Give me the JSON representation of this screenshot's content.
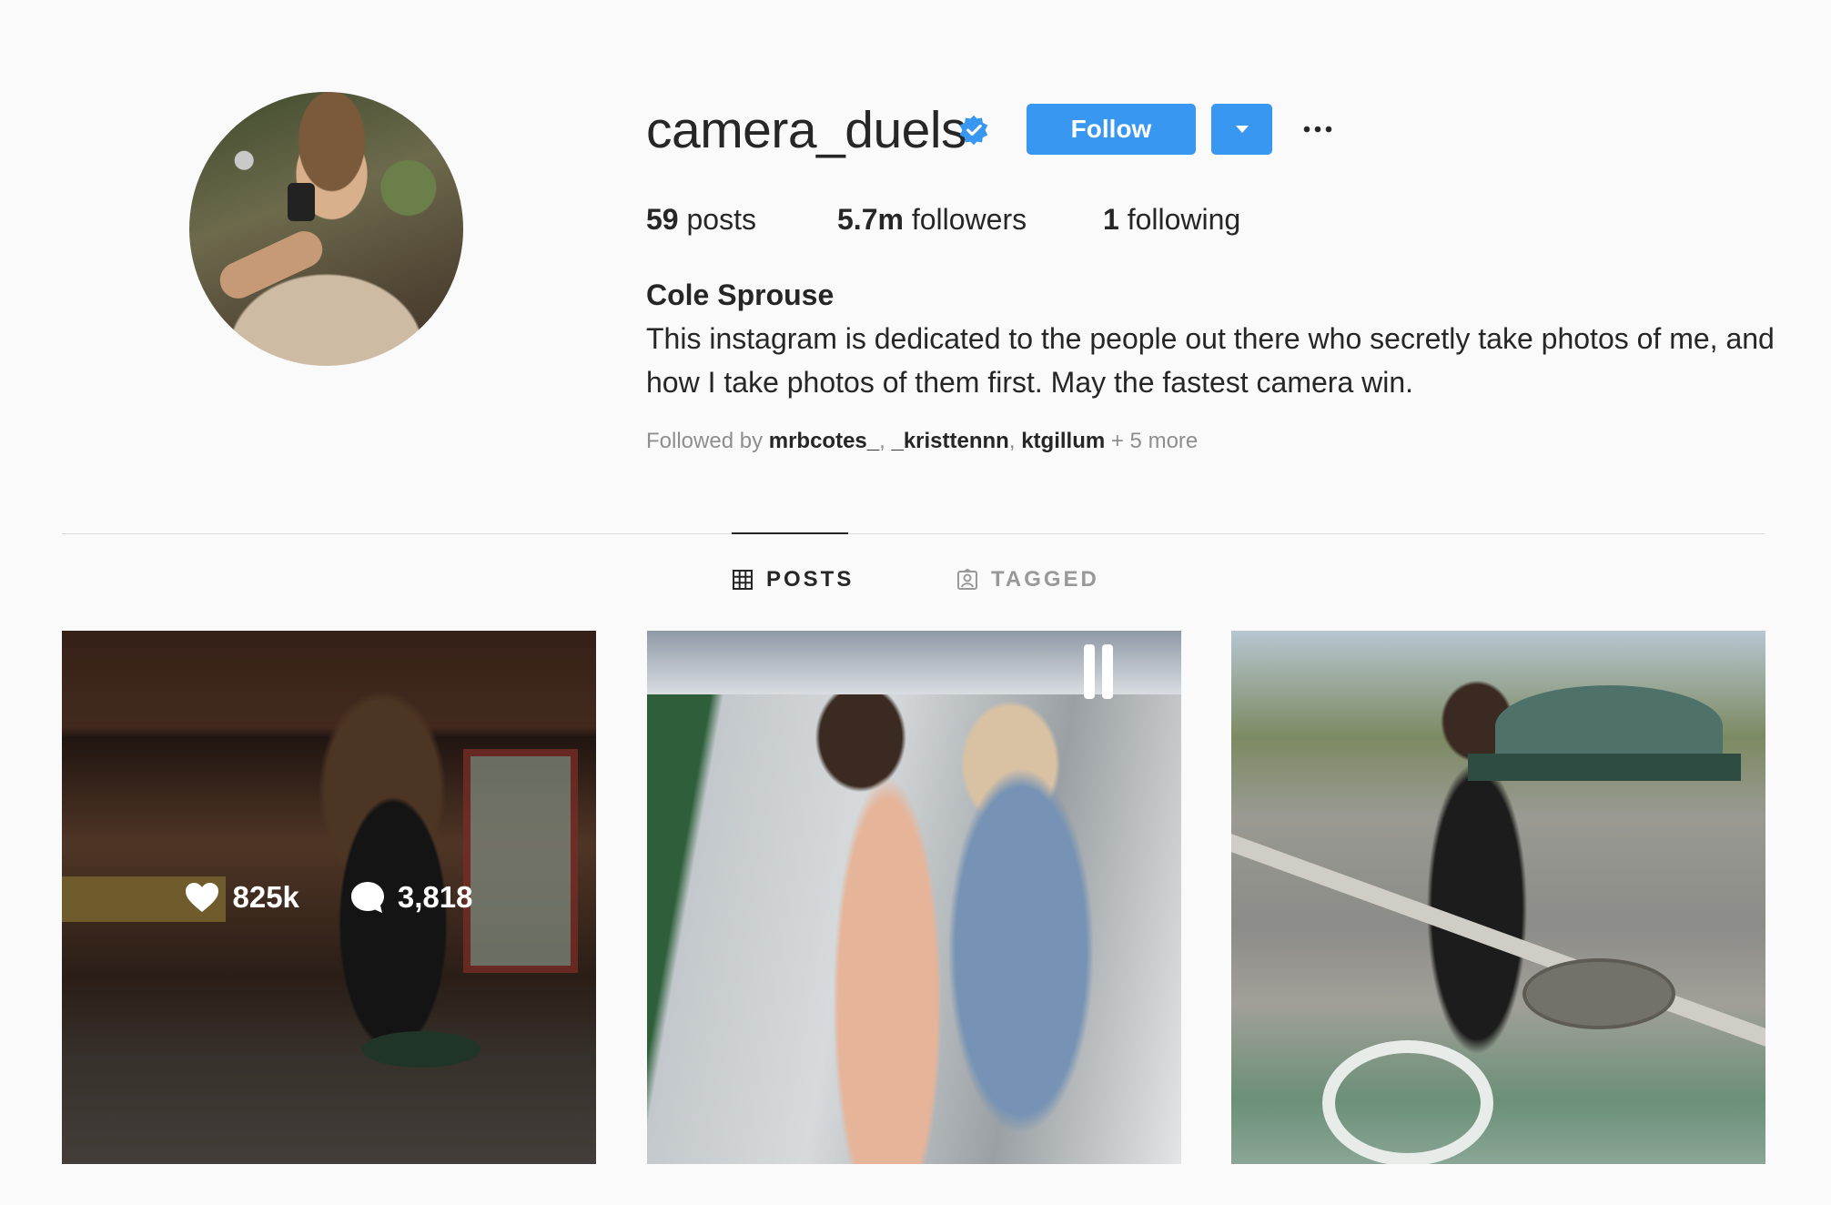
{
  "profile": {
    "username": "camera_duels",
    "verified": true,
    "follow_label": "Follow",
    "stats": {
      "posts_count": "59",
      "posts_label": "posts",
      "followers_count": "5.7m",
      "followers_label": "followers",
      "following_count": "1",
      "following_label": "following"
    },
    "full_name": "Cole Sprouse",
    "bio": "This instagram is dedicated to the people out there who secretly take photos of me, and how I take photos of them first. May the fastest camera win.",
    "followed_by": {
      "prefix": "Followed by ",
      "names": [
        "mrbcotes_",
        "_kristtennn",
        "ktgillum"
      ],
      "more": " + 5 more"
    }
  },
  "tabs": [
    {
      "label": "POSTS",
      "active": true
    },
    {
      "label": "TAGGED",
      "active": false
    }
  ],
  "posts": [
    {
      "likes": "825k",
      "comments": "3,818",
      "hovered": true
    },
    {
      "hovered": false
    },
    {
      "hovered": false
    }
  ],
  "colors": {
    "accent": "#3897f0",
    "verified": "#3897f0",
    "background": "#fafafa",
    "text": "#262626",
    "muted": "#8e8e8e"
  },
  "icons": [
    "verified-badge-icon",
    "chevron-down-icon",
    "more-options-icon",
    "grid-icon",
    "tagged-icon",
    "heart-icon",
    "comment-icon"
  ]
}
